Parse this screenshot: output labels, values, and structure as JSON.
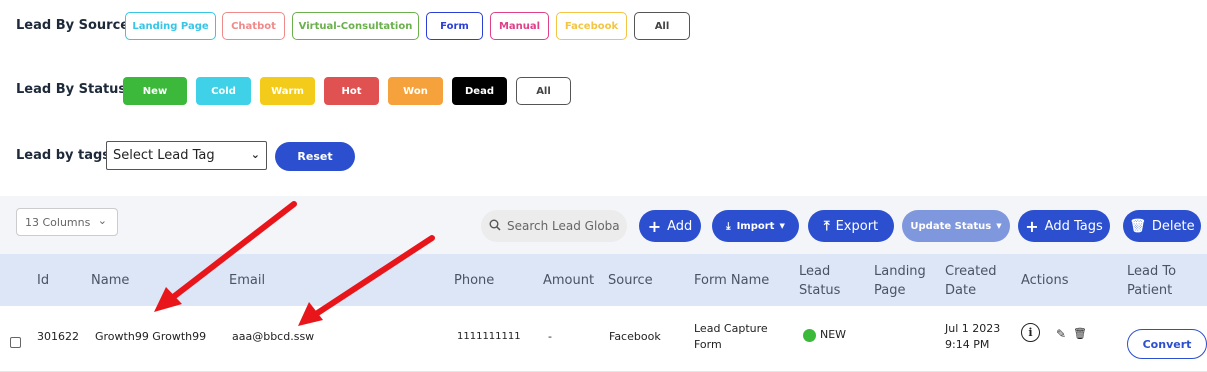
{
  "filters": {
    "source": {
      "label": "Lead By Source",
      "chips": [
        {
          "label": "Landing Page",
          "color": "#38c6e6"
        },
        {
          "label": "Chatbot",
          "color": "#ef8a8a"
        },
        {
          "label": "Virtual-Consultation",
          "color": "#6ab04c"
        },
        {
          "label": "Form",
          "color": "#2b3fd6"
        },
        {
          "label": "Manual",
          "color": "#e0408a"
        },
        {
          "label": "Facebook",
          "color": "#f4c542"
        },
        {
          "label": "All",
          "color": "#555555"
        }
      ]
    },
    "status": {
      "label": "Lead By Status",
      "buttons": [
        {
          "label": "New",
          "color": "#3cb83a"
        },
        {
          "label": "Cold",
          "color": "#3fd1e8"
        },
        {
          "label": "Warm",
          "color": "#f3cc1b"
        },
        {
          "label": "Hot",
          "color": "#e05252"
        },
        {
          "label": "Won",
          "color": "#f5a23c"
        },
        {
          "label": "Dead",
          "color": "#000000"
        },
        {
          "label": "All",
          "color": "#555555"
        }
      ]
    },
    "tags": {
      "label": "Lead by tags",
      "select_value": "Select Lead Tag",
      "reset_label": "Reset"
    }
  },
  "toolbar": {
    "columns_label": "13 Columns",
    "search_placeholder": "Search Lead Globa",
    "add_label": "Add",
    "import_label": "Import",
    "export_label": "Export",
    "update_status_label": "Update Status",
    "add_tags_label": "Add Tags",
    "delete_label": "Delete"
  },
  "table": {
    "headers": {
      "id": "Id",
      "name": "Name",
      "email": "Email",
      "phone": "Phone",
      "amount": "Amount",
      "source": "Source",
      "form_name": "Form Name",
      "lead_status_1": "Lead",
      "lead_status_2": "Status",
      "landing_page_1": "Landing",
      "landing_page_2": "Page",
      "created_date_1": "Created",
      "created_date_2": "Date",
      "actions": "Actions",
      "lead_to_patient_1": "Lead To",
      "lead_to_patient_2": "Patient"
    },
    "rows": [
      {
        "id": "301622",
        "name": "Growth99 Growth99",
        "email": "aaa@bbcd.ssw",
        "phone": "1111111111",
        "amount": "-",
        "source": "Facebook",
        "form_name_1": "Lead Capture",
        "form_name_2": "Form",
        "status": "NEW",
        "status_color": "#3cb83a",
        "created_1": "Jul 1 2023",
        "created_2": "9:14 PM",
        "convert_label": "Convert"
      }
    ]
  },
  "colors": {
    "primary": "#2b4fcf",
    "annotation_arrow": "#e8161b",
    "header_bg": "#dde6f7"
  }
}
